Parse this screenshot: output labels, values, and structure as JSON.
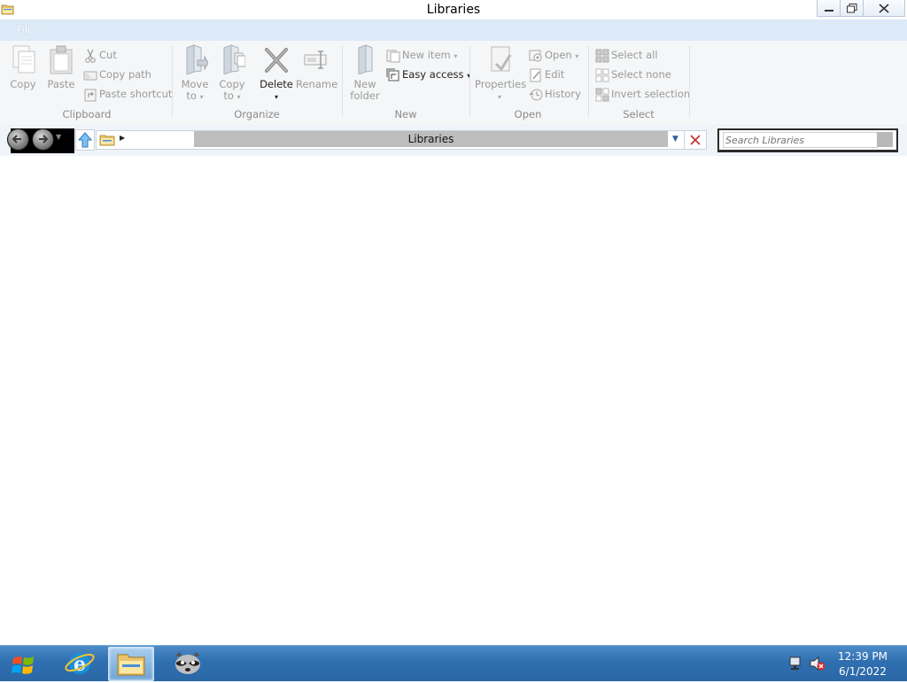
{
  "window": {
    "title": "Libraries"
  },
  "ribbon": {
    "file_tab": "File",
    "clipboard": {
      "label": "Clipboard",
      "copy": "Copy",
      "paste": "Paste",
      "cut": "Cut",
      "copy_path": "Copy path",
      "paste_shortcut": "Paste shortcut"
    },
    "organize": {
      "label": "Organize",
      "move_to": "Move",
      "move_to_2": "to",
      "copy_to": "Copy",
      "copy_to_2": "to",
      "delete": "Delete",
      "rename": "Rename"
    },
    "new": {
      "label": "New",
      "new_folder": "New",
      "new_folder_2": "folder",
      "new_item": "New item",
      "easy_access": "Easy access"
    },
    "open": {
      "label": "Open",
      "properties": "Properties",
      "open": "Open",
      "edit": "Edit",
      "history": "History"
    },
    "select": {
      "label": "Select",
      "select_all": "Select all",
      "select_none": "Select none",
      "invert_selection": "Invert selection"
    }
  },
  "address": {
    "path": "Libraries",
    "search_placeholder": "Search Libraries"
  },
  "taskbar": {
    "time": "12:39 PM",
    "date": "6/1/2022"
  },
  "colors": {
    "taskbar": "#2f6fb0",
    "ribbon_bg": "#f5f6f7",
    "tabstrip": "#dce9f6"
  }
}
